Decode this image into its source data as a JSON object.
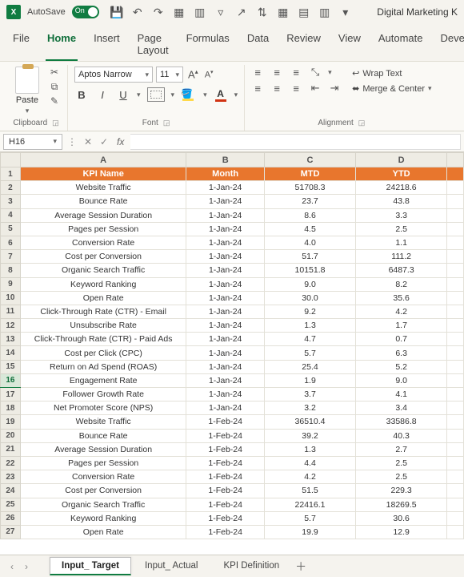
{
  "titlebar": {
    "autosave_label": "AutoSave",
    "autosave_on": "On",
    "doc_title": "Digital Marketing K"
  },
  "ribbon_tabs": [
    "File",
    "Home",
    "Insert",
    "Page Layout",
    "Formulas",
    "Data",
    "Review",
    "View",
    "Automate",
    "Developer"
  ],
  "active_tab": "Home",
  "clipboard": {
    "paste_label": "Paste",
    "group_label": "Clipboard"
  },
  "font": {
    "name": "Aptos Narrow",
    "size": "11",
    "group_label": "Font"
  },
  "alignment": {
    "wrap_label": "Wrap Text",
    "merge_label": "Merge & Center",
    "group_label": "Alignment"
  },
  "namebox": "H16",
  "columns": [
    "A",
    "B",
    "C",
    "D"
  ],
  "header_row": [
    "KPI Name",
    "Month",
    "MTD",
    "YTD"
  ],
  "rows": [
    [
      "Website Traffic",
      "1-Jan-24",
      "51708.3",
      "24218.6"
    ],
    [
      "Bounce Rate",
      "1-Jan-24",
      "23.7",
      "43.8"
    ],
    [
      "Average Session Duration",
      "1-Jan-24",
      "8.6",
      "3.3"
    ],
    [
      "Pages per Session",
      "1-Jan-24",
      "4.5",
      "2.5"
    ],
    [
      "Conversion Rate",
      "1-Jan-24",
      "4.0",
      "1.1"
    ],
    [
      "Cost per Conversion",
      "1-Jan-24",
      "51.7",
      "111.2"
    ],
    [
      "Organic Search Traffic",
      "1-Jan-24",
      "10151.8",
      "6487.3"
    ],
    [
      "Keyword Ranking",
      "1-Jan-24",
      "9.0",
      "8.2"
    ],
    [
      "Open Rate",
      "1-Jan-24",
      "30.0",
      "35.6"
    ],
    [
      "Click-Through Rate (CTR) - Email",
      "1-Jan-24",
      "9.2",
      "4.2"
    ],
    [
      "Unsubscribe Rate",
      "1-Jan-24",
      "1.3",
      "1.7"
    ],
    [
      "Click-Through Rate (CTR) - Paid Ads",
      "1-Jan-24",
      "4.7",
      "0.7"
    ],
    [
      "Cost per Click (CPC)",
      "1-Jan-24",
      "5.7",
      "6.3"
    ],
    [
      "Return on Ad Spend (ROAS)",
      "1-Jan-24",
      "25.4",
      "5.2"
    ],
    [
      "Engagement Rate",
      "1-Jan-24",
      "1.9",
      "9.0"
    ],
    [
      "Follower Growth Rate",
      "1-Jan-24",
      "3.7",
      "4.1"
    ],
    [
      "Net Promoter Score (NPS)",
      "1-Jan-24",
      "3.2",
      "3.4"
    ],
    [
      "Website Traffic",
      "1-Feb-24",
      "36510.4",
      "33586.8"
    ],
    [
      "Bounce Rate",
      "1-Feb-24",
      "39.2",
      "40.3"
    ],
    [
      "Average Session Duration",
      "1-Feb-24",
      "1.3",
      "2.7"
    ],
    [
      "Pages per Session",
      "1-Feb-24",
      "4.4",
      "2.5"
    ],
    [
      "Conversion Rate",
      "1-Feb-24",
      "4.2",
      "2.5"
    ],
    [
      "Cost per Conversion",
      "1-Feb-24",
      "51.5",
      "229.3"
    ],
    [
      "Organic Search Traffic",
      "1-Feb-24",
      "22416.1",
      "18269.5"
    ],
    [
      "Keyword Ranking",
      "1-Feb-24",
      "5.7",
      "30.6"
    ],
    [
      "Open Rate",
      "1-Feb-24",
      "19.9",
      "12.9"
    ]
  ],
  "selected_row": 16,
  "sheet_tabs": [
    "Input_ Target",
    "Input_ Actual",
    "KPI Definition"
  ],
  "active_sheet": "Input_ Target"
}
